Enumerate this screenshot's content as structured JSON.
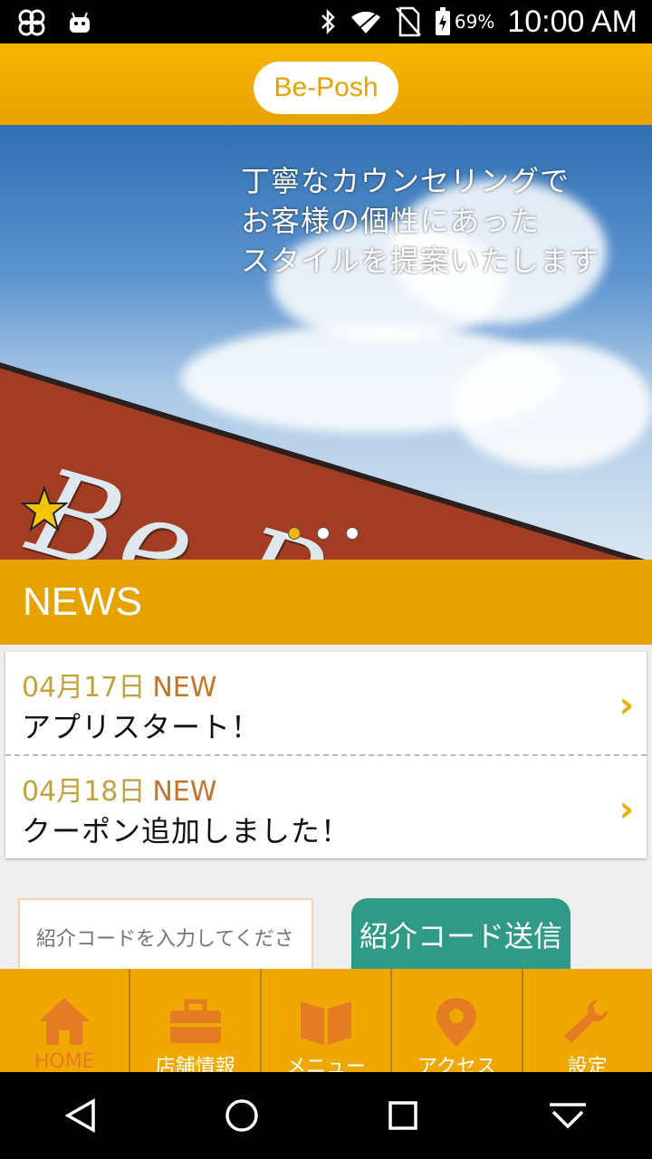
{
  "status_bar": {
    "battery_percent": "69%",
    "time": "10:00 AM"
  },
  "app_bar": {
    "brand": "Be-Posh"
  },
  "hero": {
    "caption_lines": [
      "丁寧なカウンセリングで",
      "お客様の個性にあった",
      "スタイルを提案いたします"
    ],
    "logo_text": "Be-Posh",
    "active_slide": 1,
    "slide_count": 3
  },
  "news": {
    "title": "NEWS",
    "items": [
      {
        "date": "04月17日",
        "badge": "NEW",
        "text": "アプリスタート！"
      },
      {
        "date": "04月18日",
        "badge": "NEW",
        "text": "クーポン追加しました！"
      }
    ]
  },
  "referral": {
    "placeholder": "紹介コードを入力してくださ",
    "button_label": "紹介コード送信"
  },
  "tabs": [
    {
      "label": "HOME",
      "icon": "home-icon"
    },
    {
      "label": "店舗情報",
      "icon": "briefcase-icon"
    },
    {
      "label": "メニュー",
      "icon": "book-icon"
    },
    {
      "label": "アクセス",
      "icon": "map-pin-icon"
    },
    {
      "label": "設定",
      "icon": "wrench-icon"
    }
  ],
  "colors": {
    "primary": "#e8a200",
    "accent_icon": "#e37c22",
    "button": "#2f9a86",
    "date": "#c2a240",
    "new_badge": "#c27428"
  }
}
